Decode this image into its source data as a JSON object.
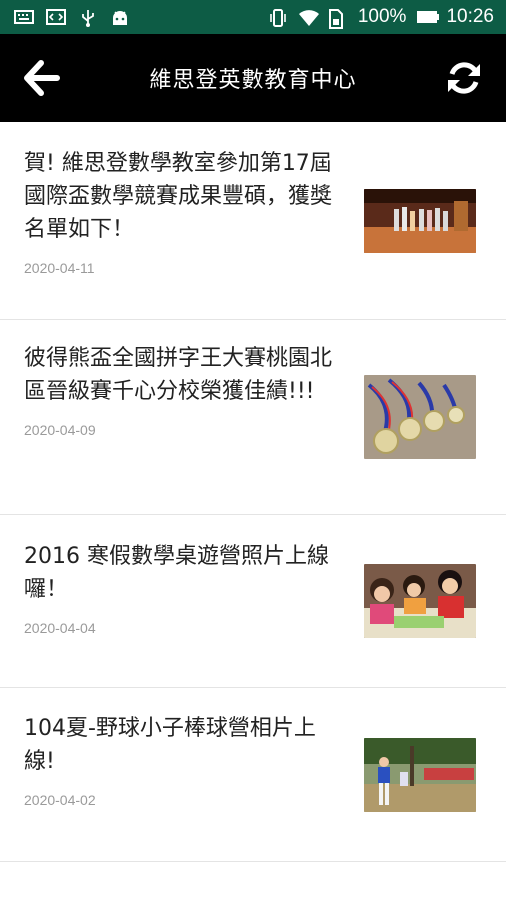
{
  "status_bar": {
    "battery": "100%",
    "time": "10:26",
    "icons": [
      "keyboard-icon",
      "code-icon",
      "usb-icon",
      "android-icon",
      "vibrate-icon",
      "wifi-icon",
      "sim-icon",
      "battery-icon"
    ]
  },
  "app_bar": {
    "title": "維思登英數教育中心",
    "back_icon": "arrow-left-icon",
    "refresh_icon": "refresh-icon"
  },
  "articles": [
    {
      "title": "賀! 維思登數學教室參加第17屆國際盃數學競賽成果豐碩，獲獎名單如下！",
      "date": "2020-04-11",
      "thumbnail": "award-ceremony-photo"
    },
    {
      "title": "彼得熊盃全國拼字王大賽桃園北區晉級賽千心分校榮獲佳績!!!",
      "date": "2020-04-09",
      "thumbnail": "medals-photo"
    },
    {
      "title": "2016 寒假數學桌遊營照片上線囉！",
      "date": "2020-04-04",
      "thumbnail": "kids-board-game-photo"
    },
    {
      "title": "104夏-野球小子棒球營相片上線!",
      "date": "2020-04-02",
      "thumbnail": "baseball-camp-photo"
    }
  ],
  "colors": {
    "status_bar": "#0d5c45",
    "app_bar": "#000000",
    "date": "#9a9a9a"
  }
}
